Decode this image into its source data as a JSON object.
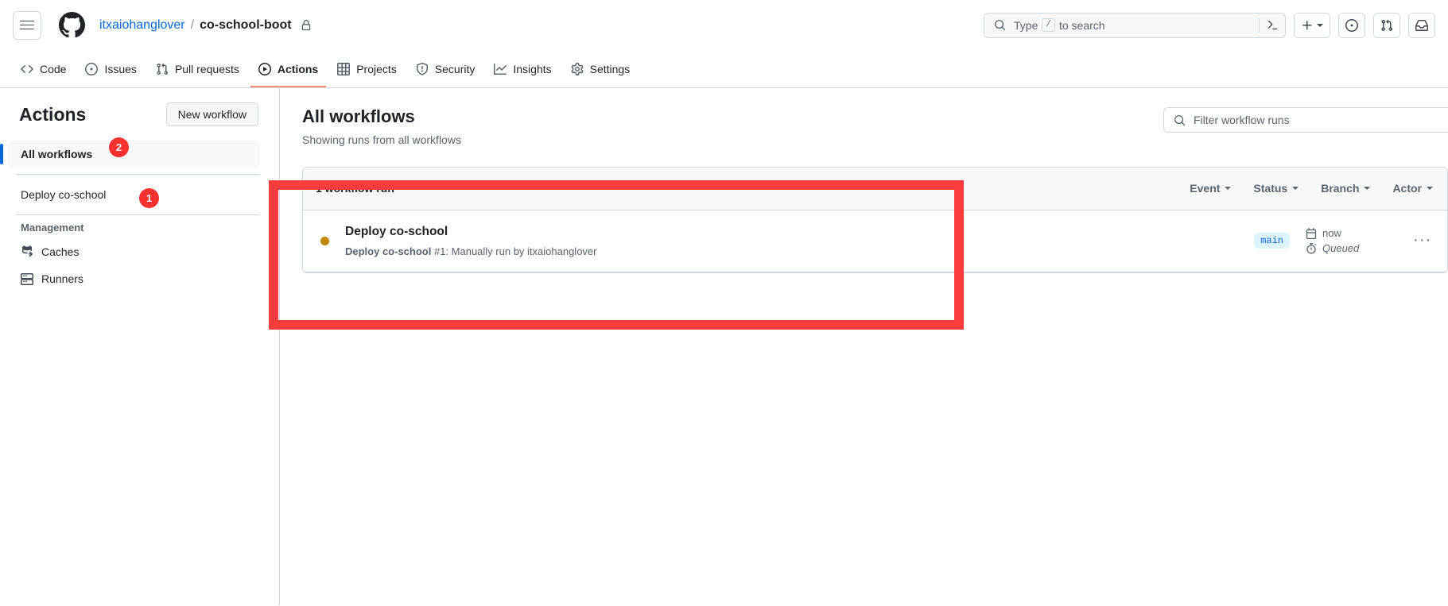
{
  "header": {
    "menu_icon": "hamburger-icon",
    "logo_icon": "github-logo-icon",
    "owner": "itxaiohanglover",
    "separator": "/",
    "repo": "co-school-boot",
    "lock_icon": "lock-icon",
    "search": {
      "placeholder_prefix": "Type",
      "key_hint": "/",
      "placeholder_suffix": "to search",
      "search_icon": "search-icon",
      "command_palette_icon": "terminal-icon"
    },
    "buttons": [
      {
        "name": "create-new-button",
        "icon": "plus-icon",
        "has_caret": true
      },
      {
        "name": "issues-button",
        "icon": "issue-opened-icon",
        "has_caret": false
      },
      {
        "name": "pull-requests-button",
        "icon": "git-pull-request-icon",
        "has_caret": false
      },
      {
        "name": "notifications-button",
        "icon": "inbox-icon",
        "has_caret": false
      }
    ]
  },
  "repo_nav": [
    {
      "label": "Code",
      "icon": "code-icon",
      "active": false
    },
    {
      "label": "Issues",
      "icon": "issue-opened-icon",
      "active": false
    },
    {
      "label": "Pull requests",
      "icon": "git-pull-request-icon",
      "active": false
    },
    {
      "label": "Actions",
      "icon": "play-icon",
      "active": true
    },
    {
      "label": "Projects",
      "icon": "table-icon",
      "active": false
    },
    {
      "label": "Security",
      "icon": "shield-icon",
      "active": false
    },
    {
      "label": "Insights",
      "icon": "graph-icon",
      "active": false
    },
    {
      "label": "Settings",
      "icon": "gear-icon",
      "active": false
    }
  ],
  "sidebar": {
    "title": "Actions",
    "new_workflow_label": "New workflow",
    "items": [
      {
        "label": "All workflows",
        "selected": true
      },
      {
        "label": "Deploy co-school",
        "selected": false
      }
    ],
    "management_label": "Management",
    "management_items": [
      {
        "label": "Caches",
        "icon": "cache-icon"
      },
      {
        "label": "Runners",
        "icon": "server-icon"
      }
    ]
  },
  "main": {
    "title": "All workflows",
    "subtitle": "Showing runs from all workflows",
    "filter_placeholder": "Filter workflow runs",
    "filter_icon": "search-icon",
    "runs_count_label": "1 workflow run",
    "filters": [
      {
        "label": "Event"
      },
      {
        "label": "Status"
      },
      {
        "label": "Branch"
      },
      {
        "label": "Actor"
      }
    ],
    "runs": [
      {
        "status_color": "#bf8700",
        "title": "Deploy co-school",
        "sub_workflow": "Deploy co-school",
        "sub_rest": " #1: Manually run by itxaiohanglover",
        "branch": "main",
        "time_icon": "calendar-icon",
        "time": "now",
        "status_icon": "stopwatch-icon",
        "status": "Queued",
        "kebab": "···"
      }
    ]
  },
  "annotations": {
    "badges": [
      {
        "label": "2",
        "name": "annotation-badge-2"
      },
      {
        "label": "1",
        "name": "annotation-badge-1"
      }
    ],
    "highlight_color": "#fa3c3c"
  }
}
